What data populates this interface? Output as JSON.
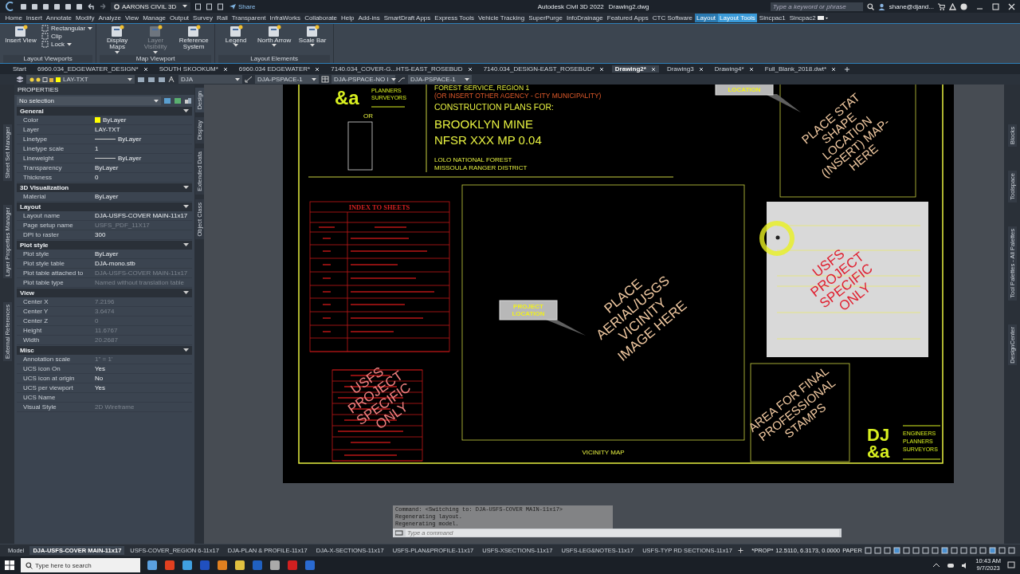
{
  "title_bar": {
    "workspace": "AARONS CIVIL 3D",
    "share": "Share",
    "app_name": "Autodesk Civil 3D 2022",
    "document": "Drawing2.dwg",
    "search": {
      "placeholder": "Type a keyword or phrase"
    },
    "user": "shane@djand..."
  },
  "ribbon_tabs": [
    {
      "label": "Home",
      "selected": false,
      "contextual": false
    },
    {
      "label": "Insert",
      "selected": false,
      "contextual": false
    },
    {
      "label": "Annotate",
      "selected": false,
      "contextual": false
    },
    {
      "label": "Modify",
      "selected": false,
      "contextual": false
    },
    {
      "label": "Analyze",
      "selected": false,
      "contextual": false
    },
    {
      "label": "View",
      "selected": false,
      "contextual": false
    },
    {
      "label": "Manage",
      "selected": false,
      "contextual": false
    },
    {
      "label": "Output",
      "selected": false,
      "contextual": false
    },
    {
      "label": "Survey",
      "selected": false,
      "contextual": false
    },
    {
      "label": "Rail",
      "selected": false,
      "contextual": false
    },
    {
      "label": "Transparent",
      "selected": false,
      "contextual": false
    },
    {
      "label": "InfraWorks",
      "selected": false,
      "contextual": false
    },
    {
      "label": "Collaborate",
      "selected": false,
      "contextual": false
    },
    {
      "label": "Help",
      "selected": false,
      "contextual": false
    },
    {
      "label": "Add-ins",
      "selected": false,
      "contextual": false
    },
    {
      "label": "SmartDraft Apps",
      "selected": false,
      "contextual": false
    },
    {
      "label": "Express Tools",
      "selected": false,
      "contextual": false
    },
    {
      "label": "Vehicle Tracking",
      "selected": false,
      "contextual": false
    },
    {
      "label": "SuperPurge",
      "selected": false,
      "contextual": false
    },
    {
      "label": "InfoDrainage",
      "selected": false,
      "contextual": false
    },
    {
      "label": "Featured Apps",
      "selected": false,
      "contextual": false
    },
    {
      "label": "CTC Software",
      "selected": false,
      "contextual": false
    },
    {
      "label": "Layout",
      "selected": false,
      "contextual": true
    },
    {
      "label": "Layout Tools",
      "selected": true,
      "contextual": true
    },
    {
      "label": "Sincpac1",
      "selected": false,
      "contextual": false
    },
    {
      "label": "Sincpac2",
      "selected": false,
      "contextual": false
    }
  ],
  "ribbon_panels": [
    {
      "title": "Layout Viewports",
      "tools": [
        {
          "label": "Insert View",
          "kind": "large",
          "disabled": false,
          "dropdown": false
        },
        {
          "label": "Rectangular",
          "kind": "small",
          "disabled": false,
          "dropdown": true
        },
        {
          "label": "Clip",
          "kind": "small",
          "disabled": false,
          "dropdown": false
        },
        {
          "label": "Lock",
          "kind": "small",
          "disabled": false,
          "dropdown": true
        }
      ]
    },
    {
      "title": "Map Viewport",
      "tools": [
        {
          "label": "Display Maps",
          "kind": "large",
          "disabled": false,
          "dropdown": true
        },
        {
          "label": "Layer Visibility",
          "kind": "large",
          "disabled": true,
          "dropdown": true
        },
        {
          "label": "Reference System",
          "kind": "large",
          "disabled": false,
          "dropdown": false
        }
      ]
    },
    {
      "title": "Layout Elements",
      "tools": [
        {
          "label": "Legend",
          "kind": "large",
          "disabled": false,
          "dropdown": true
        },
        {
          "label": "North Arrow",
          "kind": "large",
          "disabled": false,
          "dropdown": true
        },
        {
          "label": "Scale Bar",
          "kind": "large",
          "disabled": false,
          "dropdown": true
        }
      ]
    }
  ],
  "file_tabs": [
    {
      "label": "Start",
      "selected": false
    },
    {
      "label": "6960.034_EDGEWATER_DESIGN*",
      "selected": false
    },
    {
      "label": "SOUTH SKOOKUM*",
      "selected": false
    },
    {
      "label": "6960.034 EDGEWATER*",
      "selected": false
    },
    {
      "label": "7140.034_COVER-G...HTS-EAST_ROSEBUD",
      "selected": false
    },
    {
      "label": "7140.034_DESIGN-EAST_ROSEBUD*",
      "selected": false
    },
    {
      "label": "Drawing2*",
      "selected": true
    },
    {
      "label": "Drawing3",
      "selected": false
    },
    {
      "label": "Drawing4*",
      "selected": false
    },
    {
      "label": "Full_Blank_2018.dwt*",
      "selected": false
    }
  ],
  "toolbar": {
    "layer": "LAY-TXT",
    "text_style": "DJA",
    "dim_style": "DJA-PSPACE-1",
    "table_style": "DJA-PSPACE-NO I",
    "multileader_style": "DJA-PSPACE-1"
  },
  "left_palette_tabs": [
    "Sheet Set Manager",
    "Layer Properties Manager",
    "External References"
  ],
  "properties": {
    "title": "PROPERTIES",
    "selection": "No selection",
    "side_tabs": [
      {
        "label": "Design",
        "selected": true
      },
      {
        "label": "Display",
        "selected": false
      },
      {
        "label": "Extended Data",
        "selected": false
      },
      {
        "label": "Object Class",
        "selected": false
      }
    ],
    "sections": [
      {
        "title": "General",
        "expanded": true,
        "rows": [
          {
            "label": "Color",
            "value": "ByLayer",
            "kind": "swatch",
            "color": "#ffff00",
            "dim": false
          },
          {
            "label": "Layer",
            "value": "LAY-TXT",
            "kind": "text",
            "dim": false
          },
          {
            "label": "Linetype",
            "value": "ByLayer",
            "kind": "line",
            "dim": false
          },
          {
            "label": "Linetype scale",
            "value": "1",
            "kind": "text",
            "dim": false
          },
          {
            "label": "Lineweight",
            "value": "ByLayer",
            "kind": "line",
            "dim": false
          },
          {
            "label": "Transparency",
            "value": "ByLayer",
            "kind": "text",
            "dim": false
          },
          {
            "label": "Thickness",
            "value": "0",
            "kind": "text",
            "dim": false
          }
        ]
      },
      {
        "title": "3D Visualization",
        "expanded": true,
        "rows": [
          {
            "label": "Material",
            "value": "ByLayer",
            "kind": "text",
            "dim": false
          }
        ]
      },
      {
        "title": "Layout",
        "expanded": true,
        "rows": [
          {
            "label": "Layout name",
            "value": "DJA-USFS-COVER MAIN-11x17",
            "kind": "text",
            "dim": false
          },
          {
            "label": "Page setup name",
            "value": "USFS_PDF_11X17",
            "kind": "text",
            "dim": true
          },
          {
            "label": "DPI to raster",
            "value": "300",
            "kind": "text",
            "dim": false
          }
        ]
      },
      {
        "title": "Plot style",
        "expanded": true,
        "rows": [
          {
            "label": "Plot style",
            "value": "ByLayer",
            "kind": "text",
            "dim": false
          },
          {
            "label": "Plot style table",
            "value": "DJA-mono.stb",
            "kind": "text",
            "dim": false
          },
          {
            "label": "Plot table attached to",
            "value": "DJA-USFS-COVER MAIN-11x17",
            "kind": "text",
            "dim": true
          },
          {
            "label": "Plot table type",
            "value": "Named without translation table",
            "kind": "text",
            "dim": true
          }
        ]
      },
      {
        "title": "View",
        "expanded": true,
        "rows": [
          {
            "label": "Center X",
            "value": "7.2196",
            "kind": "text",
            "dim": true
          },
          {
            "label": "Center Y",
            "value": "3.6474",
            "kind": "text",
            "dim": true
          },
          {
            "label": "Center Z",
            "value": "0",
            "kind": "text",
            "dim": true
          },
          {
            "label": "Height",
            "value": "11.6767",
            "kind": "text",
            "dim": true
          },
          {
            "label": "Width",
            "value": "20.2687",
            "kind": "text",
            "dim": true
          }
        ]
      },
      {
        "title": "Misc",
        "expanded": true,
        "rows": [
          {
            "label": "Annotation scale",
            "value": "1\" = 1'",
            "kind": "text",
            "dim": true
          },
          {
            "label": "UCS icon On",
            "value": "Yes",
            "kind": "text",
            "dim": false
          },
          {
            "label": "UCS icon at origin",
            "value": "No",
            "kind": "text",
            "dim": false
          },
          {
            "label": "UCS per viewport",
            "value": "Yes",
            "kind": "text",
            "dim": false
          },
          {
            "label": "UCS Name",
            "kind": "text"
          },
          {
            "label": "Visual Style",
            "value": "2D Wireframe",
            "kind": "text",
            "dim": true
          }
        ]
      }
    ]
  },
  "right_palette_tabs": [
    "Blocks",
    "Toolspace",
    "Tool Palettes - All Palettes",
    "DesignCenter"
  ],
  "sheet": {
    "logo_top": {
      "mark": "&a",
      "lines": [
        "PLANNERS",
        "SURVEYORS"
      ]
    },
    "or_label": "OR",
    "agency": "FOREST SERVICE,  REGION 1",
    "agency_note": "(OR INSERT OTHER AGENCY - CITY MUNICIPALITY)",
    "plans_for": "CONSTRUCTION PLANS FOR:",
    "project_title": [
      "BROOKLYN MINE",
      "NFSR XXX MP 0.04"
    ],
    "forest": [
      "LOLO NATIONAL FOREST",
      "MISSOULA RANGER DISTRICT"
    ],
    "index_title": "INDEX TO SHEETS",
    "index_overlay": [
      "USFS",
      "PROJECT",
      "SPECIFIC",
      "ONLY"
    ],
    "vicinity": {
      "placeholder": [
        "PLACE",
        "AERIAL/USGS",
        "VICINITY",
        "IMAGE HERE"
      ],
      "callout": [
        "PROJECT",
        "LOCATION"
      ],
      "caption": "VICINITY MAP"
    },
    "state_map": {
      "callout": "LOCATION",
      "placeholder": [
        "PLACE STAT",
        "SHAPE",
        "LOCATION",
        "(INSERT) MAP-",
        "HERE"
      ]
    },
    "approval_overlay": [
      "USFS",
      "PROJECT",
      "SPECIFIC",
      "ONLY"
    ],
    "stamp_area": [
      "AREA FOR FINAL",
      "PROFESSIONAL",
      "STAMPS"
    ],
    "logo_bottom": {
      "mark_top": "DJ",
      "mark_bottom": "&a",
      "lines": [
        "ENGINEERS",
        "PLANNERS",
        "SURVEYORS"
      ]
    }
  },
  "command_line": {
    "history": [
      "Command:  <Switching to: DJA-USFS-COVER MAIN-11x17>",
      "Regenerating layout.",
      "Regenerating model."
    ],
    "placeholder": "Type a command"
  },
  "layout_tabs": [
    {
      "label": "Model",
      "selected": false
    },
    {
      "label": "DJA-USFS-COVER MAIN-11x17",
      "selected": true
    },
    {
      "label": "USFS-COVER_REGION 6-11x17",
      "selected": false
    },
    {
      "label": "DJA-PLAN & PROFILE-11x17",
      "selected": false
    },
    {
      "label": "DJA-X-SECTIONS-11x17",
      "selected": false
    },
    {
      "label": "USFS-PLAN&PROFILE-11x17",
      "selected": false
    },
    {
      "label": "USFS-XSECTIONS-11x17",
      "selected": false
    },
    {
      "label": "USFS-LEG&NOTES-11x17",
      "selected": false
    },
    {
      "label": "USFS-TYP RD SECTIONS-11x17",
      "selected": false
    }
  ],
  "status_bar": {
    "property": "*PROP*",
    "coordinates": "12.5110, 6.3173, 0.0000",
    "space": "PAPER"
  },
  "taskbar": {
    "search": {
      "placeholder": "Type here to search"
    },
    "time": "10:43 AM",
    "date": "9/7/2023"
  }
}
